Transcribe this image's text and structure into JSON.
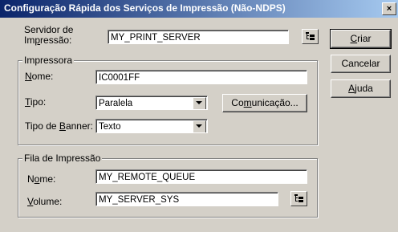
{
  "window": {
    "title": "Configuração Rápida dos Serviços de Impressão (Não-NDPS)",
    "close_glyph": "×"
  },
  "server": {
    "label_line1": "Servidor de",
    "label_line2_pre": "Im",
    "label_line2_key": "p",
    "label_line2_post": "ressão:",
    "value": "MY_PRINT_SERVER"
  },
  "printer_group": {
    "title": "Impressora",
    "name_key": "N",
    "name_rest": "ome:",
    "name_value": "IC0001FF",
    "type_key": "T",
    "type_rest": "ipo:",
    "type_value": "Paralela",
    "comm_pre": "Co",
    "comm_key": "m",
    "comm_post": "unicação...",
    "banner_pre": "Tipo de ",
    "banner_key": "B",
    "banner_post": "anner:",
    "banner_value": "Texto"
  },
  "queue_group": {
    "title": "Fila de Impressão",
    "name_pre": "N",
    "name_key": "o",
    "name_post": "me:",
    "name_value": "MY_REMOTE_QUEUE",
    "volume_key": "V",
    "volume_rest": "olume:",
    "volume_value": "MY_SERVER_SYS"
  },
  "buttons": {
    "create_key": "C",
    "create_rest": "riar",
    "cancel": "Cancelar",
    "help_key": "A",
    "help_rest": "juda"
  },
  "icons": {
    "browse": "browse-tree-icon",
    "dropdown": "dropdown-arrow-icon",
    "close": "close-icon"
  }
}
